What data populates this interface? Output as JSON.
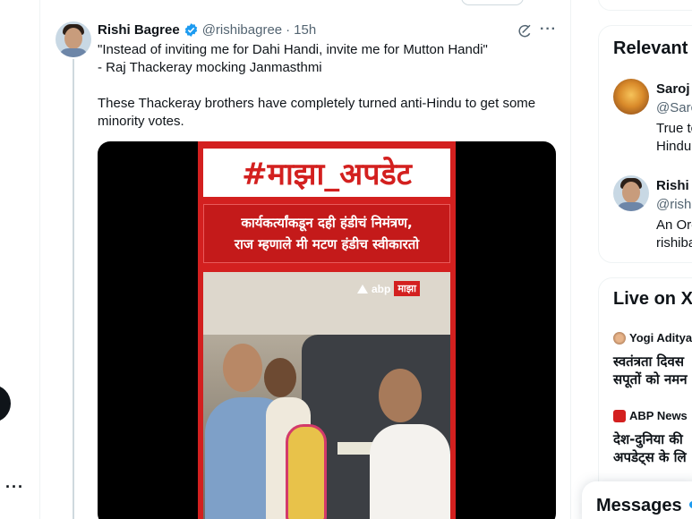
{
  "tweet": {
    "author_name": "Rishi Bagree",
    "author_handle": "@rishibagree",
    "separator": "·",
    "time": "15h",
    "more_label": "···",
    "lines": [
      "\"Instead of inviting me for Dahi Handi, invite me for Mutton Handi\"",
      "- Raj Thackeray mocking Janmasthmi"
    ],
    "body_lines": [
      "These Thackeray brothers have completely turned anti-Hindu to get some",
      "minority votes."
    ]
  },
  "media": {
    "title": "#माझा_अपडेट",
    "subtitle_lines": [
      "कार्यकर्त्यांकडून दही हंडीचं निमंत्रण,",
      "राज म्हणाले मी मटण हंडीच स्वीकारतो"
    ],
    "logo_text": "abp",
    "logo_tag": "माझा"
  },
  "sidebar": {
    "relevant_title": "Relevant",
    "people": [
      {
        "name": "Saroj",
        "handle": "@Sarc",
        "bio_lines": [
          "True tc",
          "Hindu"
        ]
      },
      {
        "name": "Rishi I",
        "handle": "@rishi",
        "bio_lines": [
          "An Ore",
          "rishiba"
        ]
      }
    ],
    "live_title": "Live on X",
    "live_items": [
      {
        "source": "Yogi Aditya",
        "title_lines": [
          "स्वतंत्रता दिवस",
          "सपूतों को नमन"
        ]
      },
      {
        "source": "ABP News",
        "title_lines": [
          "देश-दुनिया की",
          "अपडेट्स के लि"
        ]
      }
    ]
  },
  "nav": {
    "more_label": "···"
  },
  "messages": {
    "label": "Messages"
  },
  "colors": {
    "accent": "#1d9bf0",
    "media_red": "#d3201f",
    "text": "#0f1419",
    "muted": "#536471"
  }
}
